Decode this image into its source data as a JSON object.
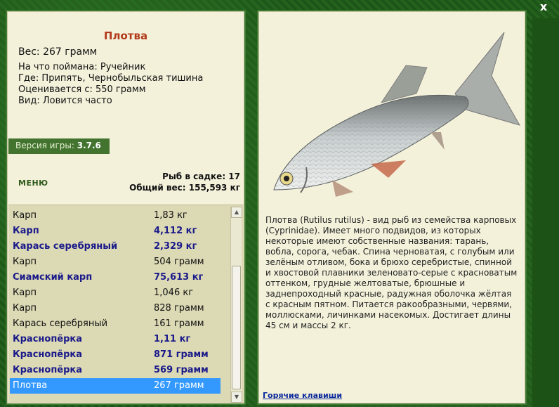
{
  "fish": {
    "name": "Плотва",
    "weight_line": "Вес: 267 грамм",
    "bait_line": "На что поймана: Ручейник",
    "location_line": "Где: Припять, Чернобыльская тишина",
    "value_line": "Оценивается с: 550 грамм",
    "kind_line": "Вид: Ловится часто"
  },
  "version": {
    "label": "Версия игры: ",
    "number": "3.7.6"
  },
  "menu_label": "МЕНЮ",
  "stats": {
    "count_line": "Рыб в садке: 17",
    "total_line": "Общий вес: 155,593 кг"
  },
  "catches": [
    {
      "name": "Карп",
      "weight": "1,83 кг",
      "bold": false
    },
    {
      "name": "Карп",
      "weight": "4,112 кг",
      "bold": true
    },
    {
      "name": "Карась серебряный",
      "weight": "2,329 кг",
      "bold": true
    },
    {
      "name": "Карп",
      "weight": "504 грамм",
      "bold": false
    },
    {
      "name": "Сиамский карп",
      "weight": "75,613 кг",
      "bold": true
    },
    {
      "name": "Карп",
      "weight": "1,046 кг",
      "bold": false
    },
    {
      "name": "Карп",
      "weight": "828 грамм",
      "bold": false
    },
    {
      "name": "Карась серебряный",
      "weight": "161 грамм",
      "bold": false
    },
    {
      "name": "Краснопёрка",
      "weight": "1,11 кг",
      "bold": true
    },
    {
      "name": "Краснопёрка",
      "weight": "871 грамм",
      "bold": true
    },
    {
      "name": "Краснопёрка",
      "weight": "569 грамм",
      "bold": true
    },
    {
      "name": "Плотва",
      "weight": "267 грамм",
      "bold": false,
      "selected": true
    }
  ],
  "description": "Плотва (Rutilus rutilus) - вид рыб из семейства карповых (Cyprinidae). Имеет много подвидов, из которых некоторые имеют собственные названия: тарань, вобла, сорога, чебак. Спина черноватая, с голубым или зелёным отливом, бока и брюхо серебристые, спинной и хвостовой плавники зеленовато-серые с красноватым оттенком, грудные желтоватые, брюшные и заднепроходный красные, радужная оболочка жёлтая с красным пятном. Питается ракообразными, червями, моллюсками, личинками насекомых. Достигает длины 45 см и массы 2 кг.",
  "hotkeys_label": "Горячие клавиши",
  "close_label": "x",
  "icons": {
    "close": "close-icon",
    "scroll_up": "chevron-up-icon",
    "scroll_down": "chevron-down-icon"
  },
  "colors": {
    "title": "#b13a1a",
    "bold_entry": "#1a1a8a",
    "selected": "#3399ff",
    "panel": "#f4f1db",
    "frame": "#3f7a33"
  }
}
